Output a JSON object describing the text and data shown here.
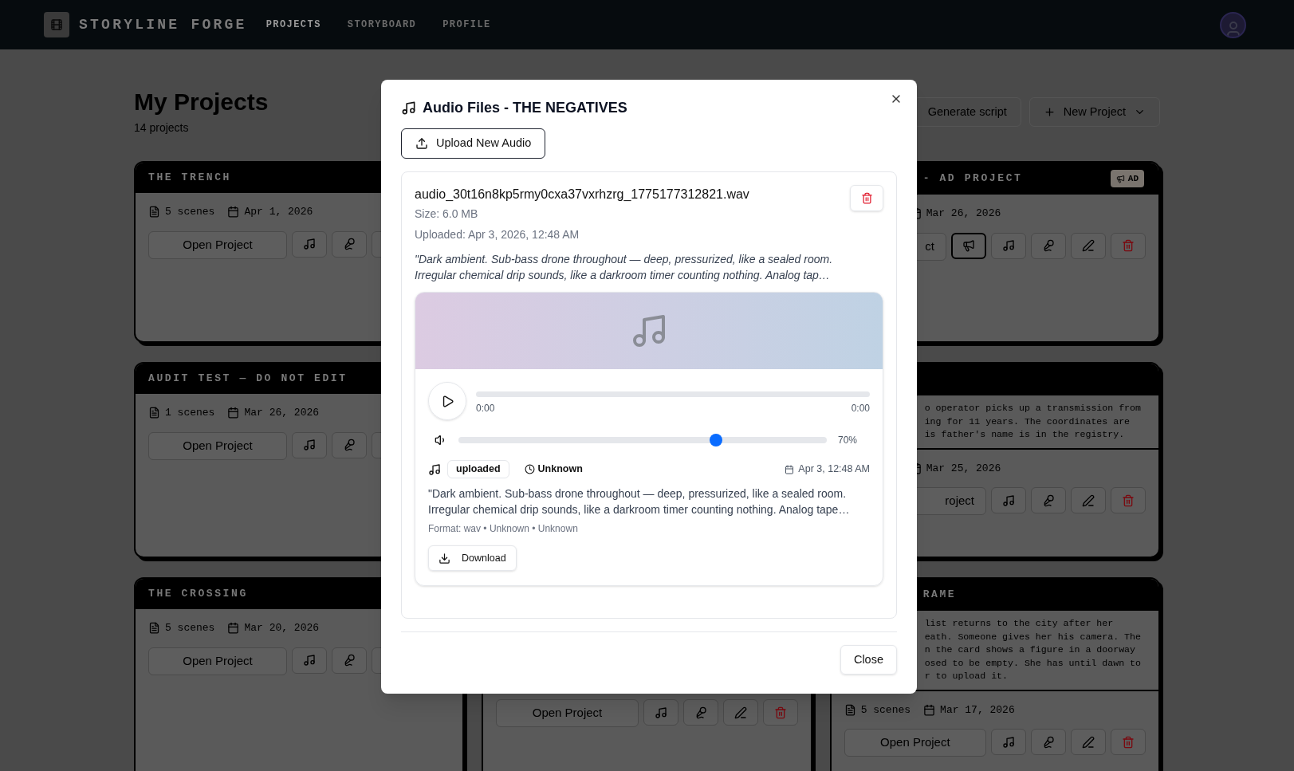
{
  "header": {
    "brand": "STORYLINE FORGE",
    "nav": [
      {
        "label": "PROJECTS",
        "selected": true
      },
      {
        "label": "STORYBOARD",
        "selected": false
      },
      {
        "label": "PROFILE",
        "selected": false
      }
    ]
  },
  "page": {
    "title": "My Projects",
    "count": "14 projects",
    "actions": [
      {
        "kind": "plain",
        "label": "Generate script"
      },
      {
        "kind": "menu",
        "label": "New Project"
      }
    ]
  },
  "left_cards": [
    {
      "title": "THE TRENCH",
      "scenes": "5 scenes",
      "date": "Apr 1, 2026",
      "open": "Open Project"
    },
    {
      "title": "AUDIT TEST — DO NOT EDIT",
      "scenes": "1 scenes",
      "date": "Mar 26, 2026",
      "open": "Open Project"
    },
    {
      "title": "THE CROSSING",
      "scenes": "5 scenes",
      "date": "Mar 20, 2026",
      "open": "Open Project"
    }
  ],
  "middle_card": {
    "open": "Open Project"
  },
  "right_cards": [
    {
      "title": "- AD PROJECT",
      "badge": "AD",
      "date": "Mar 26, 2026",
      "open": "ct",
      "ad_button": true
    },
    {
      "date": "Mar 25, 2026",
      "open": "roject",
      "ad_button": false,
      "lines": [
        "o operator picks up a transmission from",
        "ing for 11 years. The coordinates are",
        "is father's name is in the registry."
      ]
    },
    {
      "title": "RAME",
      "scenes": "5 scenes",
      "date": "Mar 17, 2026",
      "open": "Open Project",
      "ad_button": false,
      "lines": [
        "list returns to the city after her",
        "eath. Someone gives her his camera. The",
        "n the card shows a figure in a doorway",
        "osed to be empty. She has until dawn to",
        "r to upload it."
      ]
    }
  ],
  "dialog": {
    "title": "Audio Files - THE NEGATIVES",
    "upload": "Upload New Audio",
    "files": [
      {
        "name": "audio_30t16n8kp5rmy0cxa37vxrhzrg_1775177312821.wav",
        "size": "Size: 6.0 MB",
        "uploaded": "Uploaded: Apr 3, 2026, 12:48 AM",
        "prompt": "\"Dark ambient. Sub-bass drone throughout — deep, pressurized, like a sealed room. Irregular chemical drip sounds, like a darkroom timer counting nothing. Analog tap…",
        "player": {
          "current": "0:00",
          "duration": "0:00",
          "volume": {
            "level": 0.7,
            "reading": "70%"
          }
        },
        "status": "uploaded",
        "length": "Unknown",
        "date": "Apr 3, 12:48 AM",
        "description": "\"Dark ambient. Sub-bass drone throughout — deep, pressurized, like a sealed room. Irregular chemical drip sounds, like a darkroom timer counting nothing. Analog tape…",
        "format": "Format: wav • Unknown • Unknown",
        "download": "Download"
      }
    ],
    "close": "Close"
  }
}
